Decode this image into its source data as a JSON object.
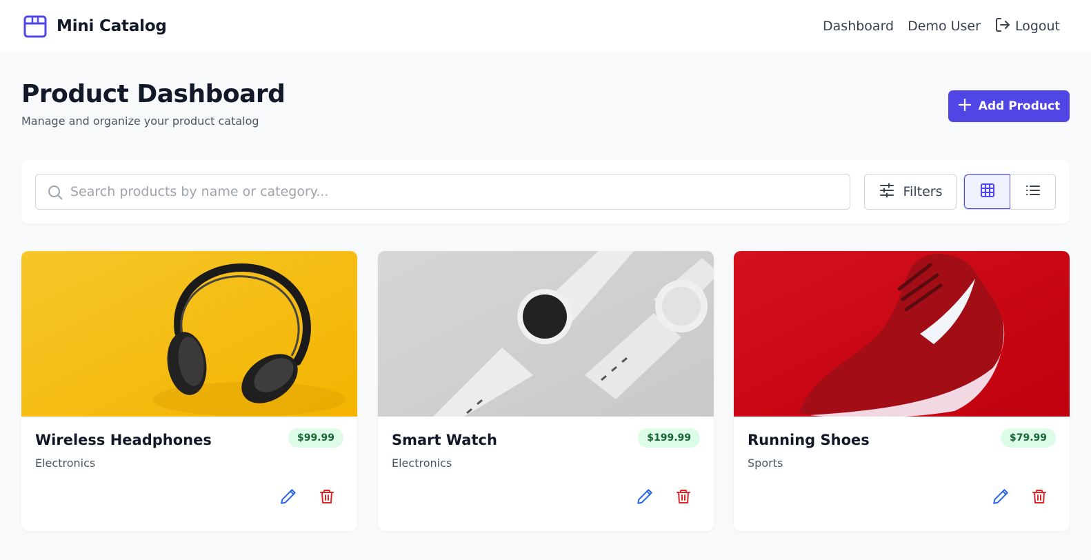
{
  "header": {
    "brand": "Mini Catalog",
    "brand_icon": "package-icon",
    "nav": {
      "dashboard": "Dashboard",
      "user": "Demo User",
      "logout": "Logout"
    }
  },
  "page": {
    "title": "Product Dashboard",
    "subtitle": "Manage and organize your product catalog",
    "add_button": "Add Product"
  },
  "toolbar": {
    "search_placeholder": "Search products by name or category...",
    "search_value": "",
    "filters_label": "Filters",
    "view_mode": "grid"
  },
  "products": [
    {
      "name": "Wireless Headphones",
      "category": "Electronics",
      "price": "$99.99",
      "image": "headphones-image"
    },
    {
      "name": "Smart Watch",
      "category": "Electronics",
      "price": "$199.99",
      "image": "smartwatch-image"
    },
    {
      "name": "Running Shoes",
      "category": "Sports",
      "price": "$79.99",
      "image": "running-shoe-image"
    }
  ],
  "colors": {
    "accent": "#4f46e5",
    "price_bg": "#dcfce7",
    "price_text": "#166534",
    "edit": "#2563eb",
    "delete": "#dc2626"
  }
}
